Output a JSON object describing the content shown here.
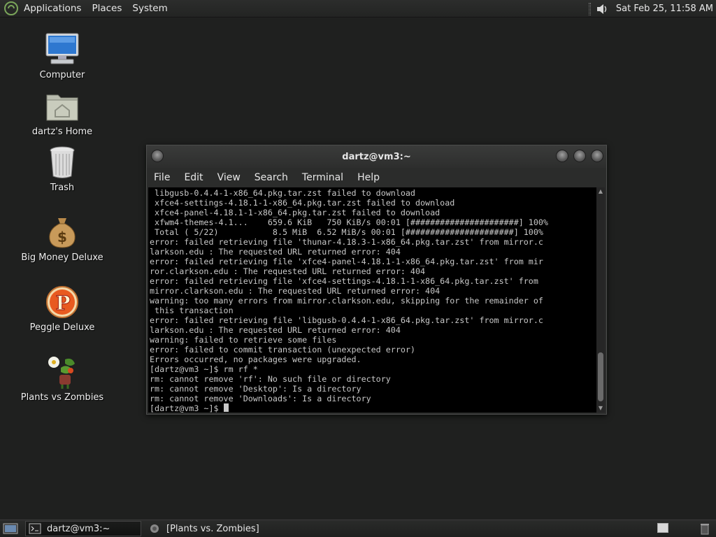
{
  "top_panel": {
    "menus": [
      "Applications",
      "Places",
      "System"
    ],
    "clock": "Sat Feb 25, 11:58 AM"
  },
  "desktop": {
    "icons": [
      {
        "label": "Computer",
        "icon": "computer-icon"
      },
      {
        "label": "dartz's Home",
        "icon": "home-folder-icon"
      },
      {
        "label": "Trash",
        "icon": "trash-icon"
      },
      {
        "label": "Big Money Deluxe",
        "icon": "money-bag-icon"
      },
      {
        "label": "Peggle Deluxe",
        "icon": "peggle-icon"
      },
      {
        "label": "Plants vs Zombies",
        "icon": "plants-vs-zombies-icon"
      }
    ]
  },
  "terminal": {
    "title": "dartz@vm3:~",
    "menu": [
      "File",
      "Edit",
      "View",
      "Search",
      "Terminal",
      "Help"
    ],
    "lines": [
      " libgusb-0.4.4-1-x86_64.pkg.tar.zst failed to download",
      " xfce4-settings-4.18.1-1-x86_64.pkg.tar.zst failed to download",
      " xfce4-panel-4.18.1-1-x86_64.pkg.tar.zst failed to download",
      " xfwm4-themes-4.1...    659.6 KiB   750 KiB/s 00:01 [######################] 100%",
      " Total ( 5/22)           8.5 MiB  6.52 MiB/s 00:01 [######################] 100%",
      "error: failed retrieving file 'thunar-4.18.3-1-x86_64.pkg.tar.zst' from mirror.c",
      "larkson.edu : The requested URL returned error: 404",
      "error: failed retrieving file 'xfce4-panel-4.18.1-1-x86_64.pkg.tar.zst' from mir",
      "ror.clarkson.edu : The requested URL returned error: 404",
      "error: failed retrieving file 'xfce4-settings-4.18.1-1-x86_64.pkg.tar.zst' from",
      "mirror.clarkson.edu : The requested URL returned error: 404",
      "warning: too many errors from mirror.clarkson.edu, skipping for the remainder of",
      " this transaction",
      "error: failed retrieving file 'libgusb-0.4.4-1-x86_64.pkg.tar.zst' from mirror.c",
      "larkson.edu : The requested URL returned error: 404",
      "warning: failed to retrieve some files",
      "error: failed to commit transaction (unexpected error)",
      "Errors occurred, no packages were upgraded.",
      "[dartz@vm3 ~]$ rm rf *",
      "rm: cannot remove 'rf': No such file or directory",
      "rm: cannot remove 'Desktop': Is a directory",
      "rm: cannot remove 'Downloads': Is a directory"
    ],
    "prompt": "[dartz@vm3 ~]$ "
  },
  "taskbar": {
    "tasks": [
      {
        "label": "dartz@vm3:~",
        "icon": "terminal-icon",
        "active": true
      },
      {
        "label": "[Plants vs. Zombies]",
        "icon": "plants-vs-zombies-icon",
        "active": false
      }
    ]
  },
  "colors": {
    "desktop_bg": "#1f201f",
    "terminal_bg": "#000000",
    "terminal_fg": "#c8c8c8"
  }
}
